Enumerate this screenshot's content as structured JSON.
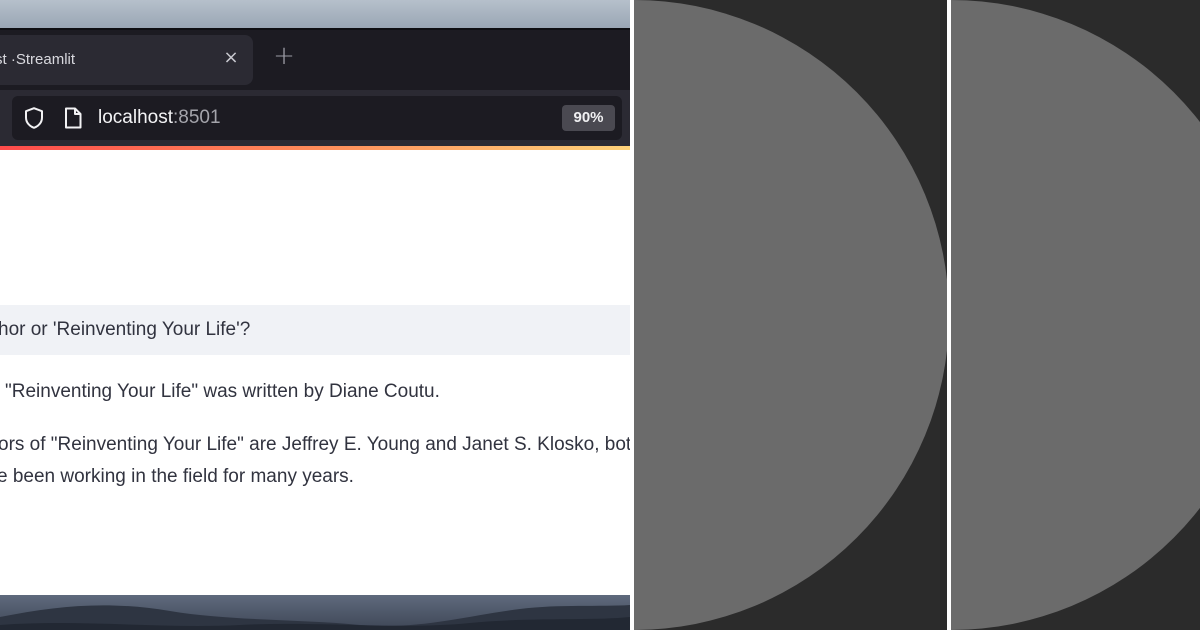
{
  "browser": {
    "tab": {
      "title_prefix": "st · ",
      "title_app": "Streamlit"
    },
    "new_tab_symbol": "+",
    "close_symbol": "×",
    "url": {
      "host": "localhost",
      "port": ":8501"
    },
    "zoom": "90%"
  },
  "page": {
    "question": "hor or 'Reinventing Your Life'?",
    "answer_line1": "\"Reinventing Your Life\" was written by Diane Coutu.",
    "answer_line2": "ors of \"Reinventing Your Life\" are Jeffrey E. Young and Janet S. Klosko, both",
    "answer_line3": "e been working in the field for many years."
  },
  "colors": {
    "half_circle": "#6b6b6b",
    "panel_background": "#2b2b2b",
    "divider": "#ffffff",
    "streamlit_accent": "#ff4b4b"
  },
  "icons": [
    "shield-icon",
    "page-icon",
    "close-icon",
    "plus-icon"
  ]
}
